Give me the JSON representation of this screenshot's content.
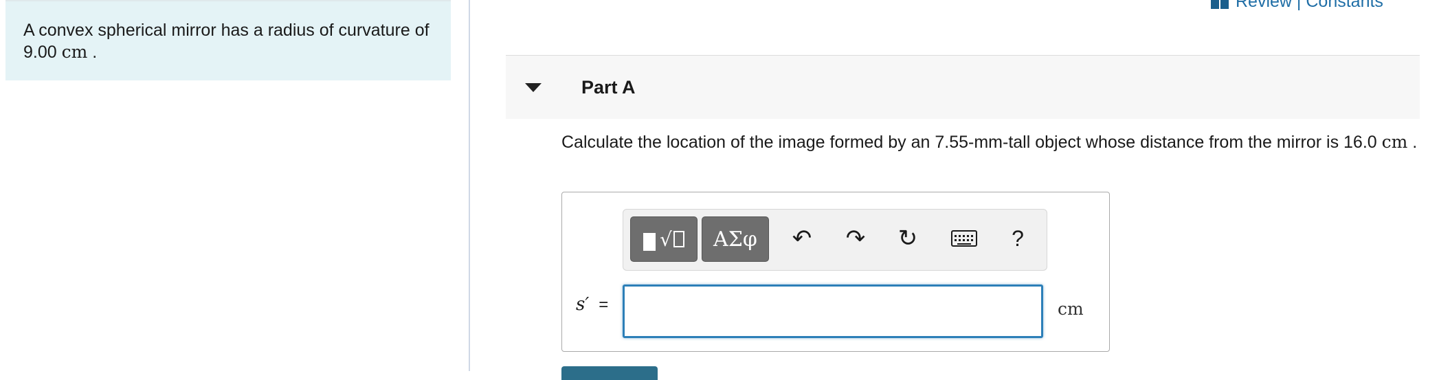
{
  "problem": {
    "statement_prefix": "A convex spherical mirror has a radius of curvature of ",
    "radius_value": "9.00",
    "radius_unit": "cm",
    "statement_suffix": " ."
  },
  "header": {
    "review_label": "Review",
    "separator": " | ",
    "constants_label": "Constants"
  },
  "part": {
    "title": "Part A",
    "question_text": "Calculate the location of the image formed by an 7.55-mm-tall object whose distance from the mirror is 16.0 ",
    "question_unit": "cm",
    "question_suffix": " ."
  },
  "toolbar": {
    "symbols_label": "ΑΣφ",
    "undo_icon": "↶",
    "redo_icon": "↷",
    "reset_icon": "↻",
    "help_label": "?"
  },
  "answer": {
    "variable": "s′",
    "equals": "=",
    "value": "",
    "unit": "cm"
  },
  "colors": {
    "accent": "#2c7fb8",
    "link": "#1f6ea6",
    "panel_bg": "#e4f3f6",
    "button_dark": "#6e6e6e"
  }
}
